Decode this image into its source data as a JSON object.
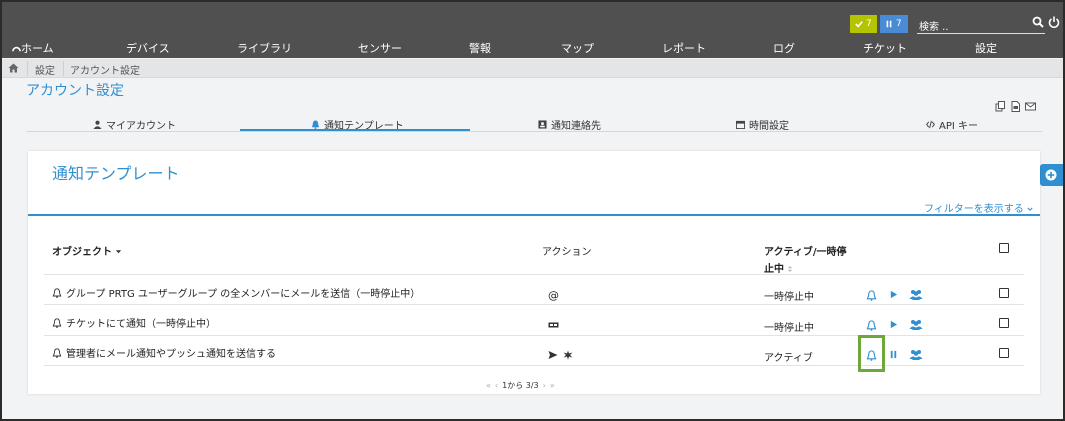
{
  "topbar": {
    "badge_ok_count": "7",
    "badge_pause_count": "7",
    "search_placeholder": "検索 ..",
    "colors": {
      "bar": "#505050",
      "ok": "#b4c400",
      "pause": "#4a8bd6",
      "accent": "#2f8fd0",
      "highlight": "#6fa83a"
    }
  },
  "nav": {
    "items": [
      "ホーム",
      "デバイス",
      "ライブラリ",
      "センサー",
      "警報",
      "マップ",
      "レポート",
      "ログ",
      "チケット",
      "設定"
    ]
  },
  "breadcrumb": {
    "items": [
      "設定",
      "アカウント設定"
    ]
  },
  "page": {
    "title": "アカウント設定"
  },
  "tabs": [
    {
      "label": "マイアカウント",
      "icon": "user-icon"
    },
    {
      "label": "通知テンプレート",
      "icon": "bell-icon"
    },
    {
      "label": "通知連絡先",
      "icon": "contact-card-icon"
    },
    {
      "label": "時間設定",
      "icon": "calendar-icon"
    },
    {
      "label": "API キー",
      "icon": "code-icon"
    }
  ],
  "panel": {
    "title": "通知テンプレート",
    "filter_label": "フィルターを表示する",
    "columns": {
      "object": "オブジェクト",
      "action": "アクション",
      "status_line1": "アクティブ/一時停",
      "status_line2": "止中"
    },
    "rows": [
      {
        "object": "グループ PRTG ユーザーグループ の全メンバーにメールを送信（一時停止中）",
        "action": "@",
        "status": "一時停止中"
      },
      {
        "object": "チケットにて通知（一時停止中）",
        "action": "ticket-icon",
        "status": "一時停止中"
      },
      {
        "object": "管理者にメール通知やプッシュ通知を送信する",
        "action": "send-push-icons",
        "status": "アクティブ"
      }
    ],
    "pager_text": "1から 3/3"
  }
}
